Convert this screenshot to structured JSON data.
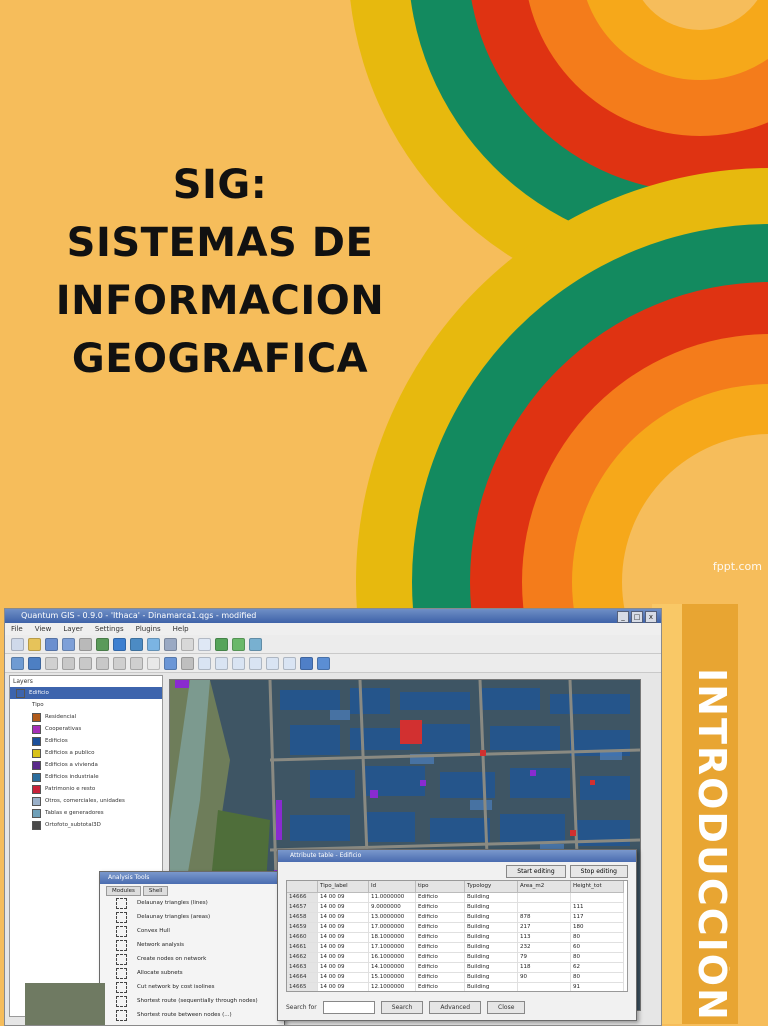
{
  "slide": {
    "title_lines": [
      "SIG:",
      "SISTEMAS DE",
      "INFORMACION",
      "GEOGRAFICA"
    ],
    "watermark": "fppt.com",
    "side_label": "INTRODUCCIÓN",
    "colors": {
      "background": "#f6bd5b",
      "yellow": "#e7b90e",
      "green": "#138a5f",
      "red": "#df3312",
      "orange": "#f47c1b",
      "amber": "#f6a81a"
    }
  },
  "screenshot": {
    "window_title": "Quantum GIS - 0.9.0 - 'Ithaca' - Dinamarca1.qgs - modified",
    "menu": [
      "File",
      "View",
      "Layer",
      "Settings",
      "Plugins",
      "Help"
    ],
    "layers_label": "Layers",
    "layers": [
      {
        "name": "Edificio",
        "color": "#3d64ad",
        "top": true
      },
      {
        "name": "Tipo",
        "color": ""
      },
      {
        "name": "Residencial",
        "color": "#b05a1a"
      },
      {
        "name": "Cooperativas",
        "color": "#a52fb8"
      },
      {
        "name": "Edificios",
        "color": "#1b4f9a"
      },
      {
        "name": "Edificios a publico",
        "color": "#d8c21a"
      },
      {
        "name": "Edificios a vivienda",
        "color": "#5a2a8a"
      },
      {
        "name": "Edificios industriale",
        "color": "#2b6d9d"
      },
      {
        "name": "Patrimonio e resto",
        "color": "#c8223a"
      },
      {
        "name": "Otros, comerciales, unidades",
        "color": "#9ab0c9"
      },
      {
        "name": "Tablas e generadores",
        "color": "#6fa0b8"
      },
      {
        "name": "Ortofoto_subtotal3D",
        "color": "#4a4a4a",
        "top": false
      }
    ],
    "attribute_table": {
      "title": "Attribute table - Edificio",
      "columns": [
        "Tipo_label",
        "Id",
        "tipo",
        "Typology",
        "Area_m2",
        "Height_tot"
      ],
      "rows": [
        [
          "14666",
          "14 00 09",
          "11.0000000",
          "Edificio",
          "Building",
          "",
          ""
        ],
        [
          "14657",
          "14 00 09",
          "9.0000000",
          "Edificio",
          "Building",
          "",
          "111"
        ],
        [
          "14658",
          "14 00 09",
          "13.0000000",
          "Edificio",
          "Building",
          "878",
          "117"
        ],
        [
          "14659",
          "14 00 09",
          "17.0000000",
          "Edificio",
          "Building",
          "217",
          "180"
        ],
        [
          "14660",
          "14 00 09",
          "18.1000000",
          "Edificio",
          "Building",
          "113",
          "80"
        ],
        [
          "14661",
          "14 00 09",
          "17.1000000",
          "Edificio",
          "Building",
          "232",
          "60"
        ],
        [
          "14662",
          "14 00 09",
          "16.1000000",
          "Edificio",
          "Building",
          "79",
          "80"
        ],
        [
          "14663",
          "14 00 09",
          "14.1000000",
          "Edificio",
          "Building",
          "118",
          "62"
        ],
        [
          "14664",
          "14 00 09",
          "15.1000000",
          "Edificio",
          "Building",
          "90",
          "80"
        ],
        [
          "14665",
          "14 00 09",
          "12.1000000",
          "Edificio",
          "Building",
          "",
          "91"
        ]
      ],
      "search_label": "Search for",
      "search_button": "Search",
      "advanced_button": "Advanced",
      "close_button": "Close",
      "top_buttons": [
        "Start editing",
        "Stop editing"
      ]
    },
    "toolbox": {
      "title": "Analysis Tools",
      "tabs": [
        "Modules",
        "Shell"
      ],
      "items": [
        "Delaunay triangles (lines)",
        "Delaunay triangles (areas)",
        "Convex Hull",
        "Network analysis",
        "Create nodes on network",
        "Allocate subnets",
        "Cut network by cost isolines",
        "Shortest route (sequentially through nodes)",
        "Shortest route between nodes (...)"
      ]
    }
  }
}
